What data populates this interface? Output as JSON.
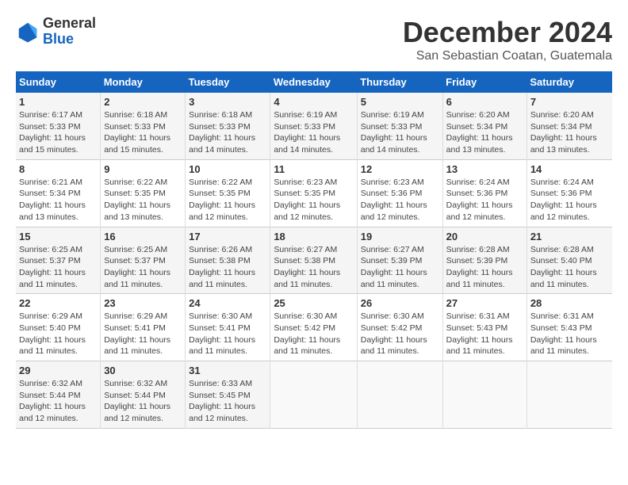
{
  "header": {
    "logo_general": "General",
    "logo_blue": "Blue",
    "month_title": "December 2024",
    "location": "San Sebastian Coatan, Guatemala"
  },
  "calendar": {
    "headers": [
      "Sunday",
      "Monday",
      "Tuesday",
      "Wednesday",
      "Thursday",
      "Friday",
      "Saturday"
    ],
    "weeks": [
      [
        {
          "day": "",
          "info": ""
        },
        {
          "day": "2",
          "info": "Sunrise: 6:18 AM\nSunset: 5:33 PM\nDaylight: 11 hours\nand 15 minutes."
        },
        {
          "day": "3",
          "info": "Sunrise: 6:18 AM\nSunset: 5:33 PM\nDaylight: 11 hours\nand 14 minutes."
        },
        {
          "day": "4",
          "info": "Sunrise: 6:19 AM\nSunset: 5:33 PM\nDaylight: 11 hours\nand 14 minutes."
        },
        {
          "day": "5",
          "info": "Sunrise: 6:19 AM\nSunset: 5:33 PM\nDaylight: 11 hours\nand 14 minutes."
        },
        {
          "day": "6",
          "info": "Sunrise: 6:20 AM\nSunset: 5:34 PM\nDaylight: 11 hours\nand 13 minutes."
        },
        {
          "day": "7",
          "info": "Sunrise: 6:20 AM\nSunset: 5:34 PM\nDaylight: 11 hours\nand 13 minutes."
        }
      ],
      [
        {
          "day": "1",
          "info": "Sunrise: 6:17 AM\nSunset: 5:33 PM\nDaylight: 11 hours\nand 15 minutes."
        },
        {
          "day": "",
          "info": ""
        },
        {
          "day": "",
          "info": ""
        },
        {
          "day": "",
          "info": ""
        },
        {
          "day": "",
          "info": ""
        },
        {
          "day": "",
          "info": ""
        },
        {
          "day": "",
          "info": ""
        }
      ],
      [
        {
          "day": "8",
          "info": "Sunrise: 6:21 AM\nSunset: 5:34 PM\nDaylight: 11 hours\nand 13 minutes."
        },
        {
          "day": "9",
          "info": "Sunrise: 6:22 AM\nSunset: 5:35 PM\nDaylight: 11 hours\nand 13 minutes."
        },
        {
          "day": "10",
          "info": "Sunrise: 6:22 AM\nSunset: 5:35 PM\nDaylight: 11 hours\nand 12 minutes."
        },
        {
          "day": "11",
          "info": "Sunrise: 6:23 AM\nSunset: 5:35 PM\nDaylight: 11 hours\nand 12 minutes."
        },
        {
          "day": "12",
          "info": "Sunrise: 6:23 AM\nSunset: 5:36 PM\nDaylight: 11 hours\nand 12 minutes."
        },
        {
          "day": "13",
          "info": "Sunrise: 6:24 AM\nSunset: 5:36 PM\nDaylight: 11 hours\nand 12 minutes."
        },
        {
          "day": "14",
          "info": "Sunrise: 6:24 AM\nSunset: 5:36 PM\nDaylight: 11 hours\nand 12 minutes."
        }
      ],
      [
        {
          "day": "15",
          "info": "Sunrise: 6:25 AM\nSunset: 5:37 PM\nDaylight: 11 hours\nand 11 minutes."
        },
        {
          "day": "16",
          "info": "Sunrise: 6:25 AM\nSunset: 5:37 PM\nDaylight: 11 hours\nand 11 minutes."
        },
        {
          "day": "17",
          "info": "Sunrise: 6:26 AM\nSunset: 5:38 PM\nDaylight: 11 hours\nand 11 minutes."
        },
        {
          "day": "18",
          "info": "Sunrise: 6:27 AM\nSunset: 5:38 PM\nDaylight: 11 hours\nand 11 minutes."
        },
        {
          "day": "19",
          "info": "Sunrise: 6:27 AM\nSunset: 5:39 PM\nDaylight: 11 hours\nand 11 minutes."
        },
        {
          "day": "20",
          "info": "Sunrise: 6:28 AM\nSunset: 5:39 PM\nDaylight: 11 hours\nand 11 minutes."
        },
        {
          "day": "21",
          "info": "Sunrise: 6:28 AM\nSunset: 5:40 PM\nDaylight: 11 hours\nand 11 minutes."
        }
      ],
      [
        {
          "day": "22",
          "info": "Sunrise: 6:29 AM\nSunset: 5:40 PM\nDaylight: 11 hours\nand 11 minutes."
        },
        {
          "day": "23",
          "info": "Sunrise: 6:29 AM\nSunset: 5:41 PM\nDaylight: 11 hours\nand 11 minutes."
        },
        {
          "day": "24",
          "info": "Sunrise: 6:30 AM\nSunset: 5:41 PM\nDaylight: 11 hours\nand 11 minutes."
        },
        {
          "day": "25",
          "info": "Sunrise: 6:30 AM\nSunset: 5:42 PM\nDaylight: 11 hours\nand 11 minutes."
        },
        {
          "day": "26",
          "info": "Sunrise: 6:30 AM\nSunset: 5:42 PM\nDaylight: 11 hours\nand 11 minutes."
        },
        {
          "day": "27",
          "info": "Sunrise: 6:31 AM\nSunset: 5:43 PM\nDaylight: 11 hours\nand 11 minutes."
        },
        {
          "day": "28",
          "info": "Sunrise: 6:31 AM\nSunset: 5:43 PM\nDaylight: 11 hours\nand 11 minutes."
        }
      ],
      [
        {
          "day": "29",
          "info": "Sunrise: 6:32 AM\nSunset: 5:44 PM\nDaylight: 11 hours\nand 12 minutes."
        },
        {
          "day": "30",
          "info": "Sunrise: 6:32 AM\nSunset: 5:44 PM\nDaylight: 11 hours\nand 12 minutes."
        },
        {
          "day": "31",
          "info": "Sunrise: 6:33 AM\nSunset: 5:45 PM\nDaylight: 11 hours\nand 12 minutes."
        },
        {
          "day": "",
          "info": ""
        },
        {
          "day": "",
          "info": ""
        },
        {
          "day": "",
          "info": ""
        },
        {
          "day": "",
          "info": ""
        }
      ]
    ]
  }
}
